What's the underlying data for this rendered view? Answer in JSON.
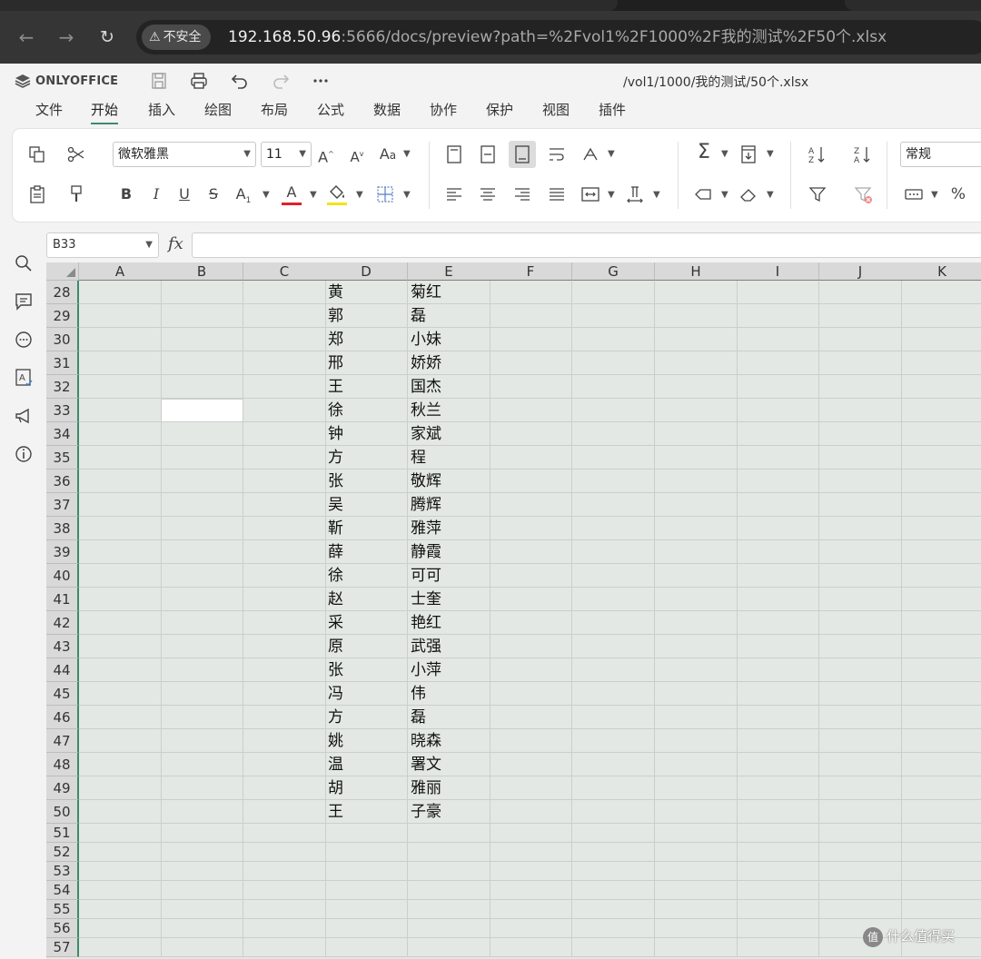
{
  "browser": {
    "security_label": "不安全",
    "url_host": "192.168.50.96",
    "url_rest": ":5666/docs/preview?path=%2Fvol1%2F1000%2F我的测试%2F50个.xlsx"
  },
  "app": {
    "logo_text": "ONLYOFFICE",
    "doc_path": "/vol1/1000/我的测试/50个.xlsx"
  },
  "menu": [
    "文件",
    "开始",
    "插入",
    "绘图",
    "布局",
    "公式",
    "数据",
    "协作",
    "保护",
    "视图",
    "插件"
  ],
  "active_menu": "开始",
  "ribbon": {
    "font_name": "微软雅黑",
    "font_size": "11",
    "number_format": "常规",
    "font_color_accent": "#e0212b",
    "fill_color_accent": "#f3e31a"
  },
  "formula_bar": {
    "cell_ref": "B33",
    "fx_label": "fx",
    "value": ""
  },
  "grid": {
    "columns": [
      "A",
      "B",
      "C",
      "D",
      "E",
      "F",
      "G",
      "H",
      "I",
      "J",
      "K"
    ],
    "selected_cell": "B33",
    "rows": [
      {
        "num": "28",
        "d": "黄",
        "e": "菊红"
      },
      {
        "num": "29",
        "d": "郭",
        "e": "磊"
      },
      {
        "num": "30",
        "d": "郑",
        "e": "小妹"
      },
      {
        "num": "31",
        "d": "邢",
        "e": "娇娇"
      },
      {
        "num": "32",
        "d": "王",
        "e": "国杰"
      },
      {
        "num": "33",
        "d": "徐",
        "e": "秋兰"
      },
      {
        "num": "34",
        "d": "钟",
        "e": "家斌"
      },
      {
        "num": "35",
        "d": "方",
        "e": "程"
      },
      {
        "num": "36",
        "d": "张",
        "e": "敬辉"
      },
      {
        "num": "37",
        "d": "吴",
        "e": "腾辉"
      },
      {
        "num": "38",
        "d": "靳",
        "e": "雅萍"
      },
      {
        "num": "39",
        "d": "薛",
        "e": "静霞"
      },
      {
        "num": "40",
        "d": "徐",
        "e": "可可"
      },
      {
        "num": "41",
        "d": "赵",
        "e": "士奎"
      },
      {
        "num": "42",
        "d": "采",
        "e": "艳红"
      },
      {
        "num": "43",
        "d": "原",
        "e": "武强"
      },
      {
        "num": "44",
        "d": "张",
        "e": "小萍"
      },
      {
        "num": "45",
        "d": "冯",
        "e": "伟"
      },
      {
        "num": "46",
        "d": "方",
        "e": "磊"
      },
      {
        "num": "47",
        "d": "姚",
        "e": "晓森"
      },
      {
        "num": "48",
        "d": "温",
        "e": "署文"
      },
      {
        "num": "49",
        "d": "胡",
        "e": "雅丽"
      },
      {
        "num": "50",
        "d": "王",
        "e": "子豪"
      },
      {
        "num": "51",
        "d": "",
        "e": ""
      },
      {
        "num": "52",
        "d": "",
        "e": ""
      },
      {
        "num": "53",
        "d": "",
        "e": ""
      },
      {
        "num": "54",
        "d": "",
        "e": ""
      },
      {
        "num": "55",
        "d": "",
        "e": ""
      },
      {
        "num": "56",
        "d": "",
        "e": ""
      },
      {
        "num": "57",
        "d": "",
        "e": ""
      }
    ]
  },
  "watermark": {
    "badge": "值",
    "text": "什么值得买"
  }
}
